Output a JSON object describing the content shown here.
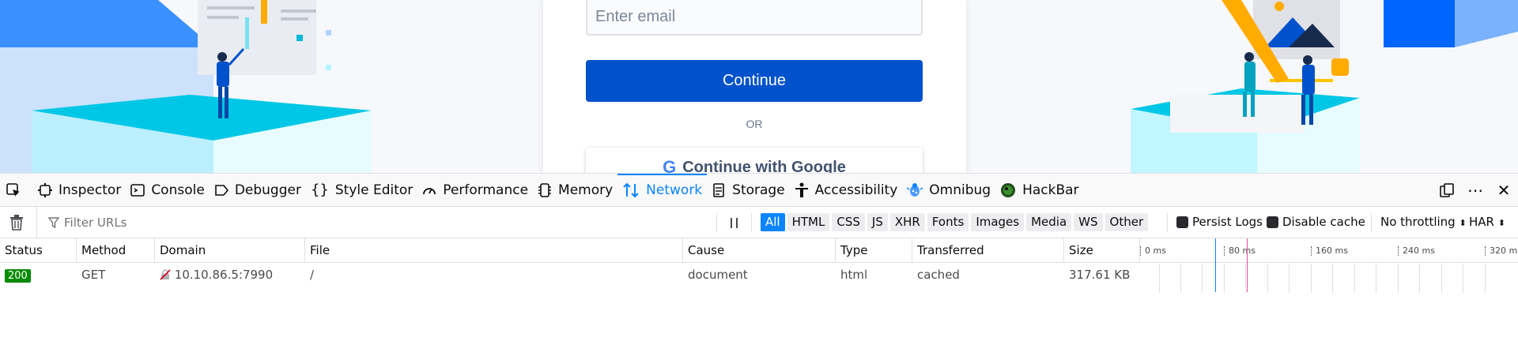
{
  "page": {
    "email_placeholder": "Enter email",
    "continue_label": "Continue",
    "or_label": "OR",
    "google_label": "Continue with Google"
  },
  "toolbox": {
    "tabs": [
      {
        "label": "Inspector",
        "icon": "inspector-icon"
      },
      {
        "label": "Console",
        "icon": "console-icon"
      },
      {
        "label": "Debugger",
        "icon": "debugger-icon"
      },
      {
        "label": "Style Editor",
        "icon": "style-editor-icon"
      },
      {
        "label": "Performance",
        "icon": "performance-icon"
      },
      {
        "label": "Memory",
        "icon": "memory-icon"
      },
      {
        "label": "Network",
        "icon": "network-icon",
        "selected": true
      },
      {
        "label": "Storage",
        "icon": "storage-icon"
      },
      {
        "label": "Accessibility",
        "icon": "accessibility-icon"
      },
      {
        "label": "Omnibug",
        "icon": "omnibug-icon"
      },
      {
        "label": "HackBar",
        "icon": "hackbar-icon"
      }
    ],
    "accent": "#0a84ff"
  },
  "network": {
    "filter_placeholder": "Filter URLs",
    "type_filters": [
      "All",
      "HTML",
      "CSS",
      "JS",
      "XHR",
      "Fonts",
      "Images",
      "Media",
      "WS",
      "Other"
    ],
    "active_filter": "All",
    "persist_logs": "Persist Logs",
    "disable_cache": "Disable cache",
    "throttling": "No throttling",
    "har": "HAR",
    "columns": [
      "Status",
      "Method",
      "Domain",
      "File",
      "Cause",
      "Type",
      "Transferred",
      "Size"
    ],
    "timeline_ticks": [
      "0 ms",
      "80 ms",
      "160 ms",
      "240 ms",
      "320 m"
    ],
    "rows": [
      {
        "status": "200",
        "method": "GET",
        "domain": "10.10.86.5:7990",
        "file": "/",
        "cause": "document",
        "type": "html",
        "transferred": "cached",
        "size": "317.61 KB"
      }
    ],
    "status_ok_color": "#058b00"
  }
}
